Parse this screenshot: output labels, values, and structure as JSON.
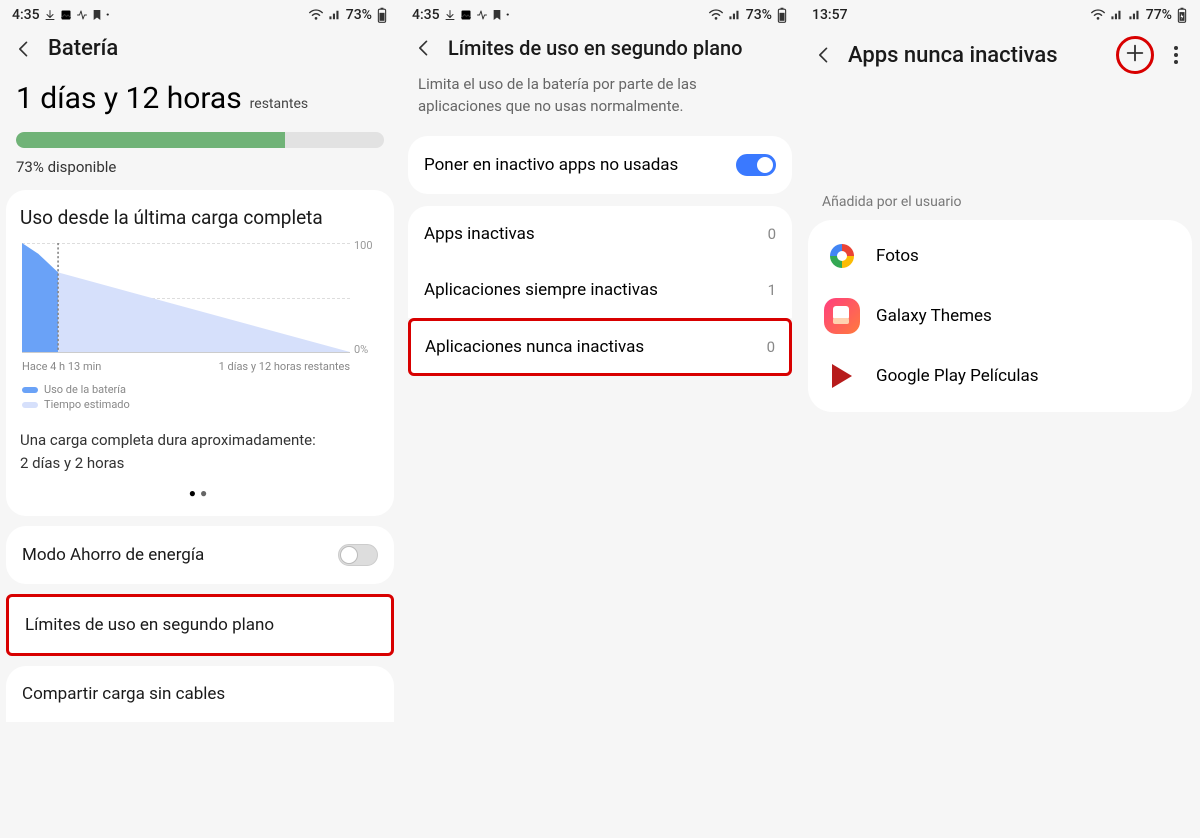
{
  "status1": {
    "time": "4:35",
    "batteryPct": "73%"
  },
  "status2": {
    "time": "4:35",
    "batteryPct": "73%"
  },
  "status3": {
    "time": "13:57",
    "batteryPct": "77%"
  },
  "screen1": {
    "title": "Batería",
    "remaining_big": "1 días y 12 horas",
    "remaining_suffix": "restantes",
    "available_text": "73% disponible",
    "card_title": "Uso desde la última carga completa",
    "x_left": "Hace 4 h 13 min",
    "x_right": "1 días y 12 horas restantes",
    "y_top": "100",
    "y_bottom": "0%",
    "legend1": "Uso de la batería",
    "legend2": "Tiempo estimado",
    "full_charge_label": "Una carga completa dura aproximadamente:",
    "full_charge_value": "2 días y 2 horas",
    "row_saving": "Modo Ahorro de energía",
    "row_limits": "Límites de uso en segundo plano",
    "row_share": "Compartir carga sin cables"
  },
  "screen2": {
    "title": "Límites de uso en segundo plano",
    "description": "Limita el uso de la batería por parte de las aplicaciones que no usas normalmente.",
    "toggle_label": "Poner en inactivo apps no usadas",
    "rows": [
      {
        "label": "Apps inactivas",
        "count": "0"
      },
      {
        "label": "Aplicaciones siempre inactivas",
        "count": "1"
      },
      {
        "label": "Aplicaciones nunca inactivas",
        "count": "0"
      }
    ]
  },
  "screen3": {
    "title": "Apps nunca inactivas",
    "section": "Añadida por el usuario",
    "apps": [
      {
        "name": "Fotos"
      },
      {
        "name": "Galaxy Themes"
      },
      {
        "name": "Google Play Películas"
      }
    ]
  },
  "colors": {
    "progress_green": "#70b377",
    "chart_used": "#6aa2f7",
    "chart_est": "#d6e0fb",
    "toggle_on": "#3a79ff",
    "highlight": "#d80000"
  },
  "chart_data": {
    "type": "area",
    "title": "Uso desde la última carga completa",
    "xlabel": "",
    "ylabel": "%",
    "ylim": [
      0,
      100
    ],
    "x_range_labels": [
      "Hace 4 h 13 min",
      "1 días y 12 horas restantes"
    ],
    "series": [
      {
        "name": "Uso de la batería",
        "color": "#6aa2f7",
        "x_fraction": [
          0.0,
          0.05,
          0.11
        ],
        "values": [
          100,
          90,
          73
        ]
      },
      {
        "name": "Tiempo estimado",
        "color": "#d6e0fb",
        "x_fraction": [
          0.11,
          1.0
        ],
        "values": [
          73,
          0
        ]
      }
    ],
    "current_percent": 73,
    "full_charge_estimate": "2 días y 2 horas"
  }
}
